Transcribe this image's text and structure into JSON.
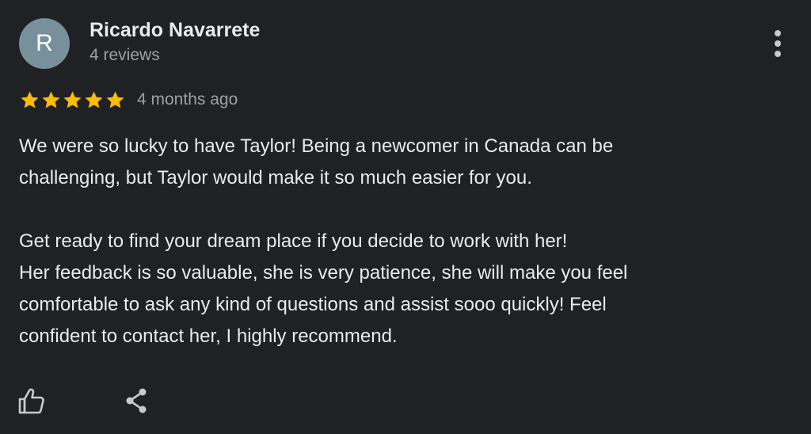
{
  "reviewer": {
    "initial": "R",
    "name": "Ricardo Navarrete",
    "reviews": "4 reviews",
    "avatar_color": "#78909c"
  },
  "review": {
    "rating": 5,
    "max_rating": 5,
    "time": "4 months ago",
    "lines": [
      "We were so lucky to have Taylor! Being a newcomer in Canada can be",
      "challenging, but Taylor would make it so much easier for you.",
      "",
      "Get ready to find your dream place if you decide to work with her!",
      "Her feedback is so valuable, she is very patience, she will make you feel",
      "comfortable to ask any kind of questions and assist sooo quickly! Feel",
      "confident to contact her, I highly recommend."
    ]
  },
  "icons": {
    "more": "more-vertical-icon",
    "star": "star-icon",
    "like": "thumbs-up-icon",
    "share": "share-icon"
  },
  "colors": {
    "background": "#202124",
    "star": "#fbbc04",
    "text": "#e8eaed",
    "secondary_text": "#9aa0a6"
  }
}
